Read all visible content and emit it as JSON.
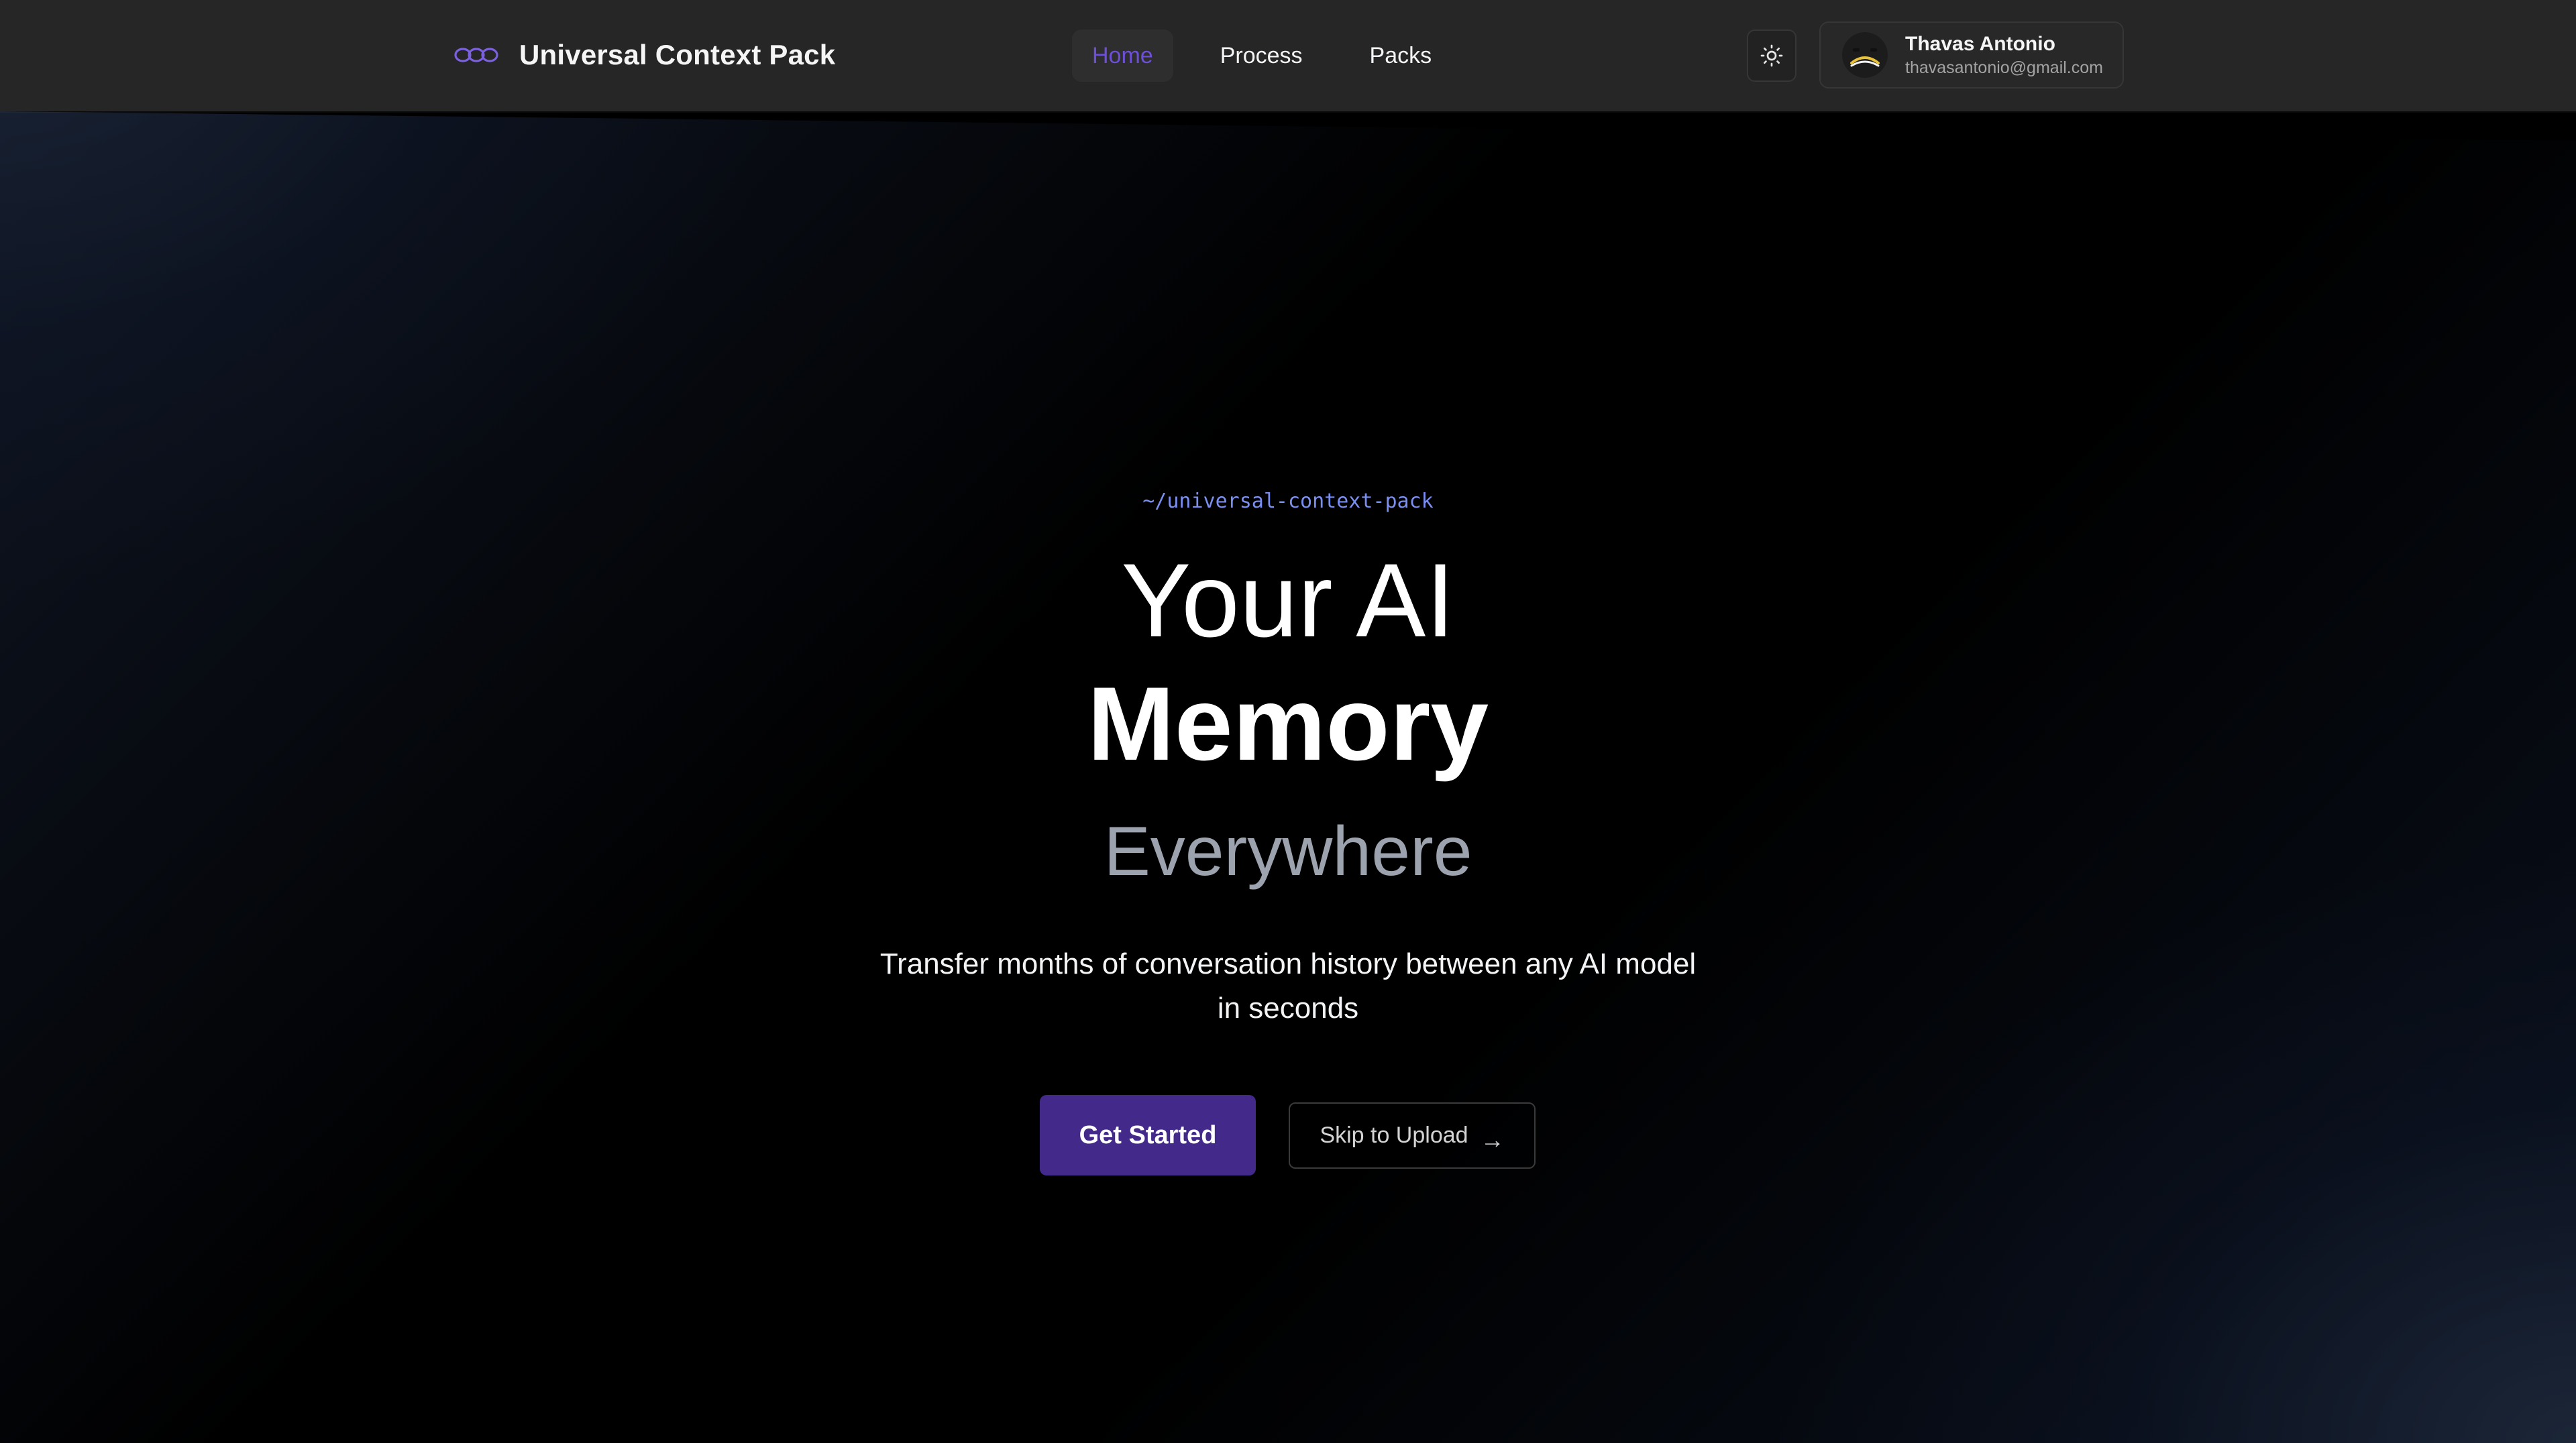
{
  "header": {
    "brand_name": "Universal Context Pack",
    "nav": [
      {
        "label": "Home",
        "active": true
      },
      {
        "label": "Process",
        "active": false
      },
      {
        "label": "Packs",
        "active": false
      }
    ],
    "theme_toggle_icon": "sun-icon",
    "user": {
      "name": "Thavas Antonio",
      "email": "thavasantonio@gmail.com",
      "avatar_icon": "frown-face-avatar"
    }
  },
  "hero": {
    "path_tag": "~/universal-context-pack",
    "title_line1": "Your AI",
    "title_line2": "Memory",
    "title_line3": "Everywhere",
    "subtitle": "Transfer months of conversation history between any AI model in seconds",
    "primary_button": "Get Started",
    "secondary_button": "Skip to Upload",
    "secondary_arrow": "→"
  },
  "colors": {
    "accent": "#42298a",
    "active_nav": "#6d4fd8",
    "path_tag": "#7b8ff0",
    "header_bg": "#262626"
  }
}
